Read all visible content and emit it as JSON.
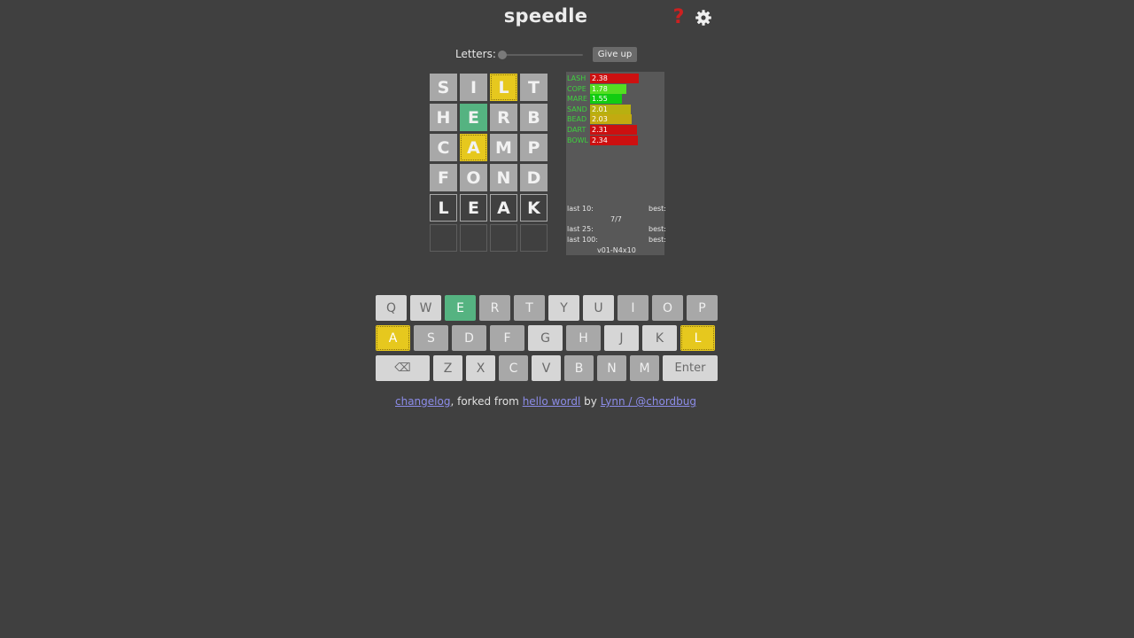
{
  "header": {
    "title": "speedle",
    "help_icon": "?",
    "settings_icon": "gear-icon"
  },
  "controls": {
    "letters_label": "Letters:",
    "letters_slider_fraction": 0.0,
    "give_up_label": "Give up"
  },
  "board": {
    "columns": 4,
    "rows": [
      [
        {
          "letter": "S",
          "state": "absent"
        },
        {
          "letter": "I",
          "state": "absent"
        },
        {
          "letter": "L",
          "state": "present"
        },
        {
          "letter": "T",
          "state": "absent"
        }
      ],
      [
        {
          "letter": "H",
          "state": "absent"
        },
        {
          "letter": "E",
          "state": "correct"
        },
        {
          "letter": "R",
          "state": "absent"
        },
        {
          "letter": "B",
          "state": "absent"
        }
      ],
      [
        {
          "letter": "C",
          "state": "absent"
        },
        {
          "letter": "A",
          "state": "present"
        },
        {
          "letter": "M",
          "state": "absent"
        },
        {
          "letter": "P",
          "state": "absent"
        }
      ],
      [
        {
          "letter": "F",
          "state": "absent"
        },
        {
          "letter": "O",
          "state": "absent"
        },
        {
          "letter": "N",
          "state": "absent"
        },
        {
          "letter": "D",
          "state": "absent"
        }
      ],
      [
        {
          "letter": "L",
          "state": "typed"
        },
        {
          "letter": "E",
          "state": "typed"
        },
        {
          "letter": "A",
          "state": "typed"
        },
        {
          "letter": "K",
          "state": "typed"
        }
      ],
      [
        {
          "letter": "",
          "state": "empty"
        },
        {
          "letter": "",
          "state": "empty"
        },
        {
          "letter": "",
          "state": "empty"
        },
        {
          "letter": "",
          "state": "empty"
        }
      ]
    ]
  },
  "stats": {
    "history": [
      {
        "word": "LASH",
        "value": "2.38",
        "color": "#cc1010"
      },
      {
        "word": "COPE",
        "value": "1.78",
        "color": "#55dd22"
      },
      {
        "word": "MARE",
        "value": "1.55",
        "color": "#11cc11"
      },
      {
        "word": "SAND",
        "value": "2.01",
        "color": "#b8b010"
      },
      {
        "word": "BEAD",
        "value": "2.03",
        "color": "#c2aa10"
      },
      {
        "word": "DART",
        "value": "2.31",
        "color": "#cc1010"
      },
      {
        "word": "BOWL",
        "value": "2.34",
        "color": "#cc1010"
      }
    ],
    "last10_label": "last 10:",
    "last10_best_label": "best:",
    "count": "7/7",
    "last25_label": "last 25:",
    "last25_best_label": "best:",
    "last100_label": "last 100:",
    "last100_best_label": "best:",
    "version": "v01-N4x10"
  },
  "keyboard": {
    "rows": [
      [
        {
          "label": "Q",
          "state": "unused"
        },
        {
          "label": "W",
          "state": "unused"
        },
        {
          "label": "E",
          "state": "correct"
        },
        {
          "label": "R",
          "state": "absent"
        },
        {
          "label": "T",
          "state": "absent"
        },
        {
          "label": "Y",
          "state": "unused"
        },
        {
          "label": "U",
          "state": "unused"
        },
        {
          "label": "I",
          "state": "absent"
        },
        {
          "label": "O",
          "state": "absent"
        },
        {
          "label": "P",
          "state": "absent"
        }
      ],
      [
        {
          "label": "A",
          "state": "present"
        },
        {
          "label": "S",
          "state": "absent"
        },
        {
          "label": "D",
          "state": "absent"
        },
        {
          "label": "F",
          "state": "absent"
        },
        {
          "label": "G",
          "state": "unused"
        },
        {
          "label": "H",
          "state": "absent"
        },
        {
          "label": "J",
          "state": "unused"
        },
        {
          "label": "K",
          "state": "unused"
        },
        {
          "label": "L",
          "state": "present"
        }
      ],
      [
        {
          "label": "⌫",
          "state": "unused"
        },
        {
          "label": "Z",
          "state": "unused"
        },
        {
          "label": "X",
          "state": "unused"
        },
        {
          "label": "C",
          "state": "absent"
        },
        {
          "label": "V",
          "state": "unused"
        },
        {
          "label": "B",
          "state": "absent"
        },
        {
          "label": "N",
          "state": "absent"
        },
        {
          "label": "M",
          "state": "absent"
        },
        {
          "label": "Enter",
          "state": "unused"
        }
      ]
    ]
  },
  "footer": {
    "changelog_link": "changelog",
    "text_forked": ", forked from ",
    "hello_link": "hello wordl",
    "text_by": " by ",
    "author_link": "Lynn / @chordbug"
  }
}
